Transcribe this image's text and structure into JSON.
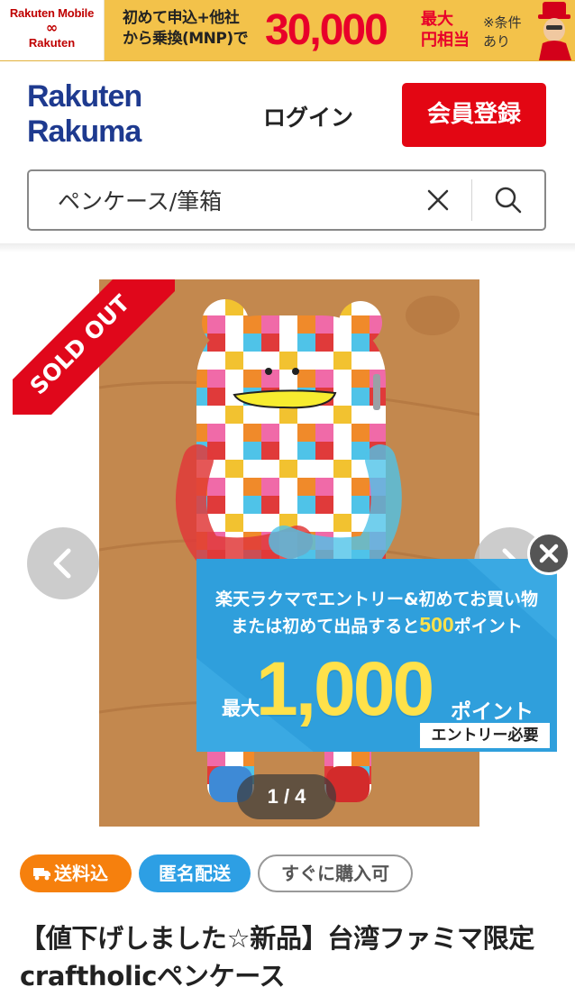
{
  "promo": {
    "brand_top": "Rakuten Mobile",
    "brand_bottom": "Rakuten",
    "text_line1": "初めて申込+他社",
    "text_line2": "から乗換(MNP)で",
    "amount": "30,000",
    "unit_line1": "最大",
    "unit_line2": "円相当",
    "note_line1": "※条件",
    "note_line2": "あり"
  },
  "header": {
    "logo_line1": "Rakuten",
    "logo_line2": "Rakuma",
    "login_label": "ログイン",
    "register_label": "会員登録"
  },
  "search": {
    "value": "ペンケース/筆箱"
  },
  "gallery": {
    "sold_label": "SOLD OUT",
    "counter": "1 / 4"
  },
  "campaign": {
    "line1": "楽天ラクマでエントリー&初めてお買い物",
    "line2_prefix": "または初めて出品すると",
    "line2_points": "500",
    "line2_suffix": "ポイント",
    "max_label": "最大",
    "amount": "1,000",
    "unit": "ポイント",
    "entry_label": "エントリー必要"
  },
  "tags": [
    {
      "label": "送料込"
    },
    {
      "label": "匿名配送"
    },
    {
      "label": "すぐに購入可"
    }
  ],
  "product": {
    "title": "【値下げしました☆新品】台湾ファミマ限定craftholicペンケース"
  },
  "colors": {
    "brand_blue": "#1e3a8f",
    "register_red": "#e30613",
    "sold_red": "#e0071b",
    "ship_orange": "#f6800d",
    "anon_blue": "#2d9fe4",
    "campaign_blue": "#2f9fdc"
  }
}
